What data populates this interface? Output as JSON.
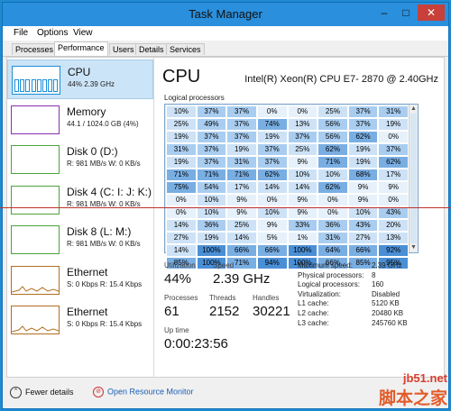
{
  "window": {
    "title": "Task Manager"
  },
  "menu": [
    "File",
    "Options",
    "View"
  ],
  "tabs": [
    "Processes",
    "Performance",
    "Users",
    "Details",
    "Services"
  ],
  "sidebar": [
    {
      "name": "CPU",
      "sub": "44% 2.39 GHz",
      "color": "#1b8fd6"
    },
    {
      "name": "Memory",
      "sub": "44.1 / 1024.0 GB (4%)",
      "color": "#8b2fb0"
    },
    {
      "name": "Disk 0 (D:)",
      "sub": "R: 981 MB/s W: 0 KB/s",
      "color": "#4ba33a"
    },
    {
      "name": "Disk 4 (C: I: J: K:)",
      "sub": "R: 981 MB/s W: 0 KB/s",
      "color": "#4ba33a"
    },
    {
      "name": "Disk 8 (L: M:)",
      "sub": "R: 981 MB/s W: 0 KB/s",
      "color": "#4ba33a"
    },
    {
      "name": "Ethernet",
      "sub": "S: 0 Kbps R: 15.4 Kbps",
      "color": "#b06f20"
    },
    {
      "name": "Ethernet",
      "sub": "S: 0 Kbps R: 15.4 Kbps",
      "color": "#b06f20"
    }
  ],
  "cpu": {
    "title": "CPU",
    "model": "Intel(R) Xeon(R) CPU E7- 2870  @ 2.40GHz",
    "logical_label": "Logical processors"
  },
  "grid": [
    [
      "10%",
      "37%",
      "37%",
      "0%",
      "0%",
      "25%",
      "37%",
      "31%"
    ],
    [
      "25%",
      "49%",
      "37%",
      "74%",
      "13%",
      "56%",
      "37%",
      "19%"
    ],
    [
      "19%",
      "37%",
      "37%",
      "19%",
      "37%",
      "56%",
      "62%",
      "0%"
    ],
    [
      "31%",
      "37%",
      "19%",
      "37%",
      "25%",
      "62%",
      "19%",
      "37%"
    ],
    [
      "19%",
      "37%",
      "31%",
      "37%",
      "9%",
      "71%",
      "19%",
      "62%"
    ],
    [
      "71%",
      "71%",
      "71%",
      "62%",
      "10%",
      "10%",
      "68%",
      "17%"
    ],
    [
      "75%",
      "54%",
      "17%",
      "14%",
      "14%",
      "62%",
      "9%",
      "9%"
    ],
    [
      "0%",
      "10%",
      "9%",
      "0%",
      "9%",
      "0%",
      "9%",
      "0%"
    ],
    [
      "0%",
      "10%",
      "9%",
      "10%",
      "9%",
      "0%",
      "10%",
      "43%"
    ],
    [
      "14%",
      "36%",
      "25%",
      "9%",
      "33%",
      "36%",
      "43%",
      "20%"
    ],
    [
      "27%",
      "19%",
      "14%",
      "5%",
      "1%",
      "31%",
      "27%",
      "13%"
    ],
    [
      "14%",
      "100%",
      "66%",
      "66%",
      "100%",
      "64%",
      "66%",
      "92%"
    ],
    [
      "85%",
      "100%",
      "71%",
      "94%",
      "100%",
      "66%",
      "85%",
      "95%"
    ]
  ],
  "stats": {
    "utilization_label": "Utilization",
    "utilization": "44%",
    "speed_label": "Speed",
    "speed": "2.39 GHz",
    "processes_label": "Processes",
    "processes": "61",
    "threads_label": "Threads",
    "threads": "2152",
    "handles_label": "Handles",
    "handles": "30221",
    "uptime_label": "Up time",
    "uptime": "0:00:23:56"
  },
  "info": [
    [
      "Maximum speed:",
      "2.39 GHz"
    ],
    [
      "Physical processors:",
      "8"
    ],
    [
      "Logical processors:",
      "160"
    ],
    [
      "Virtualization:",
      "Disabled"
    ],
    [
      "L1 cache:",
      "5120 KB"
    ],
    [
      "L2 cache:",
      "20480 KB"
    ],
    [
      "L3 cache:",
      "245760 KB"
    ]
  ],
  "footer": {
    "fewer": "Fewer details",
    "resource": "Open Resource Monitor"
  },
  "watermark": {
    "line1": "jb51.net",
    "line2": "脚本之家"
  }
}
